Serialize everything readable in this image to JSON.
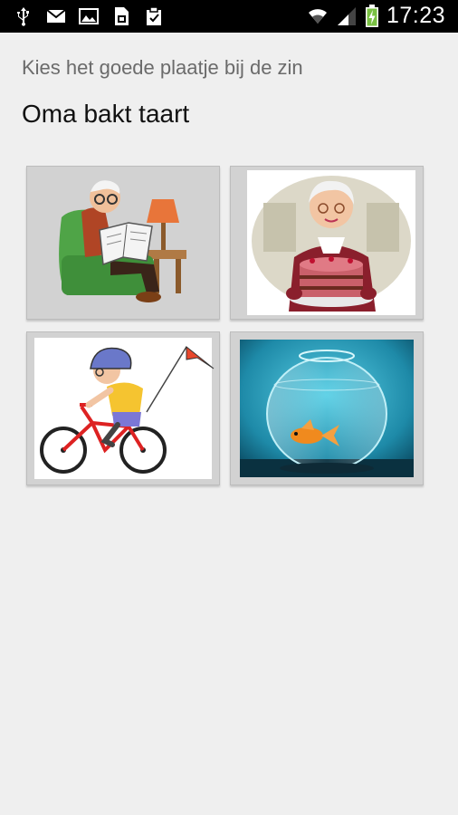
{
  "status_bar": {
    "time": "17:23",
    "left_icons": [
      "usb-icon",
      "mail-icon",
      "image-icon",
      "sim-icon",
      "clipboard-icon"
    ],
    "right_icons": [
      "wifi-icon",
      "signal-icon",
      "battery-charging-icon"
    ]
  },
  "screen": {
    "instruction": "Kies het goede plaatje bij de zin",
    "sentence": "Oma bakt taart"
  },
  "choices": [
    {
      "image": "grandpa-reading-newspaper"
    },
    {
      "image": "grandma-with-cake"
    },
    {
      "image": "boy-on-bicycle"
    },
    {
      "image": "goldfish-bowl"
    }
  ]
}
